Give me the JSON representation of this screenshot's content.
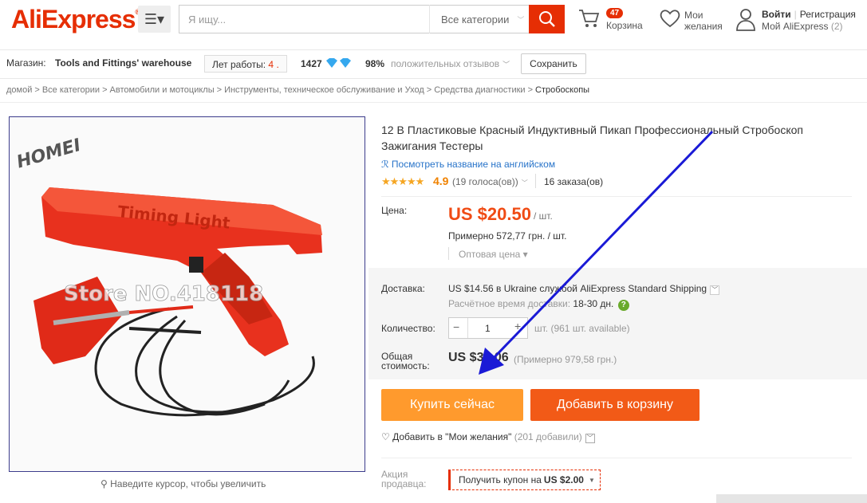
{
  "header": {
    "logo": "AliExpress",
    "logo_mark": "®",
    "search_placeholder": "Я ищу...",
    "category": "Все категории",
    "cart_count": "47",
    "cart_label": "Корзина",
    "wishlist_line1": "Мои",
    "wishlist_line2": "желания",
    "login": "Войти",
    "register": "Регистрация",
    "my_ali": "Мой AliExpress",
    "my_ali_count": "(2)"
  },
  "store": {
    "label": "Магазин:",
    "name": "Tools and Fittings' warehouse",
    "years_label": "Лет работы:",
    "years_value": "4",
    "rating_num": "1427",
    "positive_pct": "98%",
    "positive_text": "положительных отзывов",
    "save_label": "Сохранить"
  },
  "breadcrumb": [
    "домой",
    "Все категории",
    "Автомобили и мотоциклы",
    "Инструменты, техническое обслуживание и Уход",
    "Средства диагностики",
    "Стробоскопы"
  ],
  "image": {
    "watermark_brand": "HOMEI",
    "watermark_store": "Store NO.418118",
    "zoom_hint": "Наведите курсор, чтобы увеличить"
  },
  "product": {
    "title": "12 В Пластиковые Красный Индуктивный Пикап Профессиональный Стробоскоп Зажигания Тестеры",
    "translate_link": "Посмотреть название на английском",
    "score": "4.9",
    "votes": "(19 голоса(ов))",
    "orders": "16 заказа(ов)",
    "price_label": "Цена:",
    "price": "US $20.50",
    "per_unit": "/ шт.",
    "approx_price": "Примерно 572,77 грн. / шт.",
    "wholesale": "Оптовая цена",
    "shipping_label": "Доставка:",
    "shipping_value": "US $14.56 в Ukraine службой AliExpress Standard Shipping",
    "eta_label": "Расчётное время доставки:",
    "eta_days": "18-30 дн.",
    "qty_label": "Количество:",
    "qty_value": "1",
    "qty_available": "шт. (961 шт. available)",
    "total_label_1": "Общая",
    "total_label_2": "стоимость:",
    "total_value": "US $35.06",
    "total_approx": "(Примерно 979,58 грн.)",
    "buy_now": "Купить сейчас",
    "add_to_cart": "Добавить в корзину",
    "wish_add": "Добавить в \"Мои желания\"",
    "wish_count": "(201 добавили)",
    "promo_label_1": "Акция",
    "promo_label_2": "продавца:",
    "coupon_text": "Получить купон на",
    "coupon_amount": "US $2.00"
  },
  "colors": {
    "brand": "#e62e04",
    "price": "#f04b14",
    "buy_now": "#ff9a2d",
    "add_cart": "#f25a17",
    "link": "#2773c9",
    "annotation_arrow": "#1a1ad6"
  }
}
